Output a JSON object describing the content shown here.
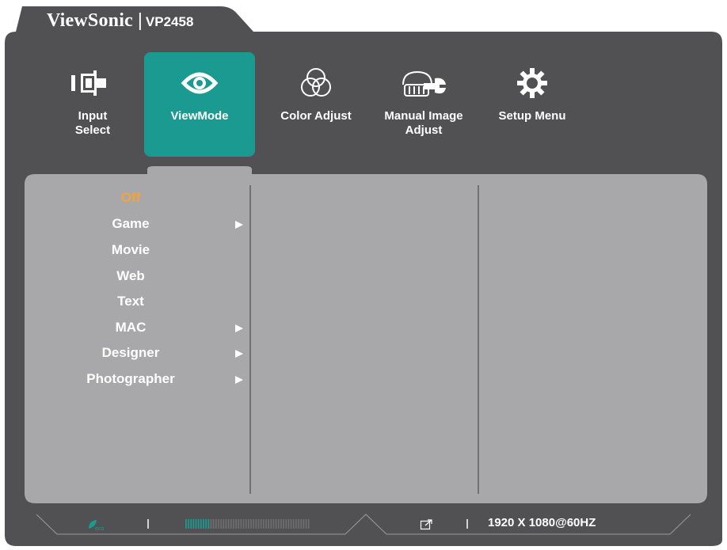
{
  "header": {
    "brand": "ViewSonic",
    "separator": "|",
    "model": "VP2458"
  },
  "tabs": [
    {
      "label": "Input\nSelect",
      "icon": "input-select-icon",
      "active": false
    },
    {
      "label": "ViewMode",
      "icon": "eye-icon",
      "active": true
    },
    {
      "label": "Color Adjust",
      "icon": "color-circles-icon",
      "active": false
    },
    {
      "label": "Manual Image\nAdjust",
      "icon": "hand-wrench-icon",
      "active": false
    },
    {
      "label": "Setup Menu",
      "icon": "gear-icon",
      "active": false
    }
  ],
  "viewmode_items": [
    {
      "label": "Off",
      "selected": true,
      "submenu": false
    },
    {
      "label": "Game",
      "selected": false,
      "submenu": true
    },
    {
      "label": "Movie",
      "selected": false,
      "submenu": false
    },
    {
      "label": "Web",
      "selected": false,
      "submenu": false
    },
    {
      "label": "Text",
      "selected": false,
      "submenu": false
    },
    {
      "label": "MAC",
      "selected": false,
      "submenu": true
    },
    {
      "label": "Designer",
      "selected": false,
      "submenu": true
    },
    {
      "label": "Photographer",
      "selected": false,
      "submenu": true
    }
  ],
  "status_bar": {
    "eco_icon": "eco-leaf-icon",
    "brightness_level": 0.2,
    "resolution": "1920 X 1080@60HZ",
    "input_icon": "input-port-icon"
  },
  "colors": {
    "osd_background": "#515153",
    "panel": "#a8a8aa",
    "active_tab": "#1b9a91",
    "selected_text": "#f2a33a",
    "text": "#ffffff"
  }
}
